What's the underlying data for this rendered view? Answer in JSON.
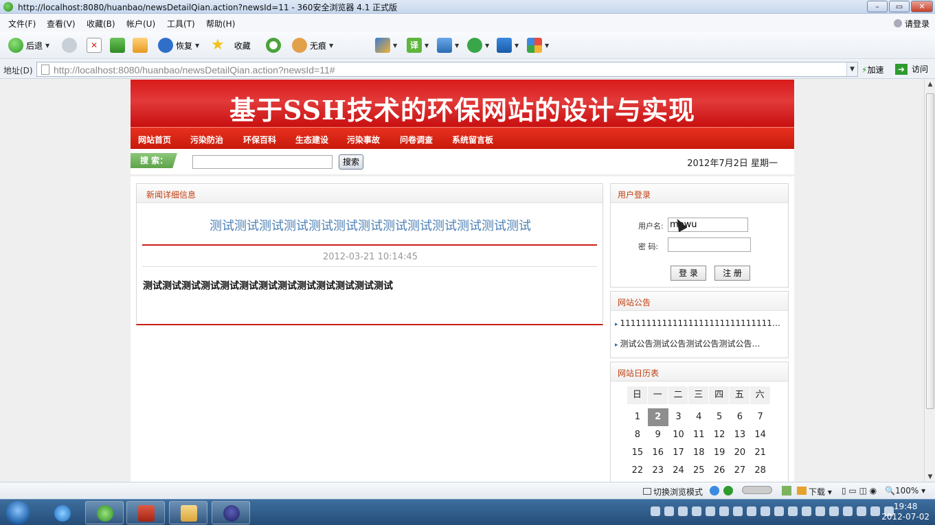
{
  "window": {
    "title": "http://localhost:8080/huanbao/newsDetailQian.action?newsId=11 - 360安全浏览器 4.1 正式版",
    "close": "✕",
    "maximize": "▭",
    "minimize": "–"
  },
  "menu": {
    "items": [
      "文件(F)",
      "查看(V)",
      "收藏(B)",
      "帐户(U)",
      "工具(T)",
      "帮助(H)"
    ],
    "login": "请登录"
  },
  "toolbar": {
    "back": "后退",
    "restore": "恢复",
    "favorites": "收藏",
    "incognito": "无痕"
  },
  "address": {
    "label": "地址(D)",
    "url": "http://localhost:8080/huanbao/newsDetailQian.action?newsId=11#",
    "speedup": "加速",
    "go": "访问"
  },
  "site": {
    "banner_title": "基于SSH技术的环保网站的设计与实现",
    "nav": [
      "网站首页",
      "污染防治",
      "环保百科",
      "生态建设",
      "污染事故",
      "问卷调查",
      "系统留言板"
    ],
    "search_label": "搜 索：",
    "search_button": "搜索",
    "date": "2012年7月2日  星期一"
  },
  "news": {
    "heading": "新闻详细信息",
    "title": "测试测试测试测试测试测试测试测试测试测试测试测试测试",
    "datetime": "2012-03-21 10:14:45",
    "body": "测试测试测试测试测试测试测试测试测试测试测试测试测试"
  },
  "login": {
    "heading": "用户登录",
    "username_label": "用户名:",
    "username_value": "mowu",
    "password_label": "密  码:",
    "login_button": "登 录",
    "register_button": "注 册"
  },
  "notice": {
    "heading": "网站公告",
    "items": [
      "1111111111111111111111111111111111",
      "测试公告测试公告测试公告测试公告…"
    ]
  },
  "calendar": {
    "heading": "网站日历表",
    "weekdays": [
      "日",
      "一",
      "二",
      "三",
      "四",
      "五",
      "六"
    ],
    "weeks": [
      [
        "1",
        "2",
        "3",
        "4",
        "5",
        "6",
        "7"
      ],
      [
        "8",
        "9",
        "10",
        "11",
        "12",
        "13",
        "14"
      ],
      [
        "15",
        "16",
        "17",
        "18",
        "19",
        "20",
        "21"
      ],
      [
        "22",
        "23",
        "24",
        "25",
        "26",
        "27",
        "28"
      ]
    ],
    "today": "2"
  },
  "status": {
    "mode": "切换浏览模式",
    "download": "下载",
    "zoom": "100%"
  },
  "taskbar": {
    "time": "19:48",
    "date": "2012-07-02"
  },
  "colors": {
    "banner_red": "#d91a1a",
    "nav_red": "#c71a0b",
    "news_title_blue": "#4b7fb5",
    "panel_heading": "#c13e10"
  }
}
